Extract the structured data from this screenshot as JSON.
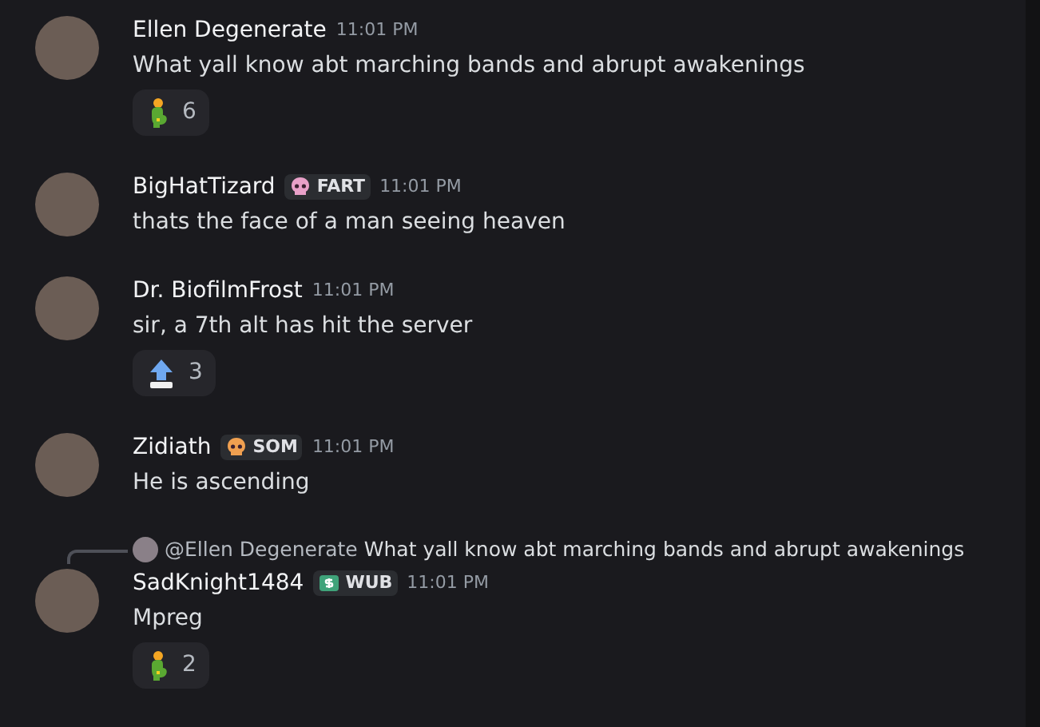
{
  "messages": [
    {
      "author": "Ellen Degenerate",
      "time": "11:01 PM",
      "text": "What yall know abt marching bands and abrupt awakenings",
      "reactions": [
        {
          "kind": "person",
          "count": "6"
        }
      ]
    },
    {
      "author": "BigHatTizard",
      "tag": {
        "kind": "skull",
        "color": "#e8a0c8",
        "label": "FART"
      },
      "time": "11:01 PM",
      "text": "thats the face of a man seeing heaven"
    },
    {
      "author": "Dr. BiofilmFrost",
      "time": "11:01 PM",
      "text": "sir, a 7th alt has hit the server",
      "reactions": [
        {
          "kind": "arrow",
          "count": "3"
        }
      ]
    },
    {
      "author": "Zidiath",
      "tag": {
        "kind": "skull",
        "color": "#f0a050",
        "label": "SOM"
      },
      "time": "11:01 PM",
      "text": "He is ascending"
    },
    {
      "reply": {
        "mention": "@Ellen Degenerate",
        "text": "What yall know abt marching bands and abrupt awakenings"
      },
      "author": "SadKnight1484",
      "tag": {
        "kind": "money",
        "label": "WUB"
      },
      "time": "11:01 PM",
      "text": "Mpreg",
      "reactions": [
        {
          "kind": "person",
          "count": "2"
        }
      ]
    }
  ]
}
